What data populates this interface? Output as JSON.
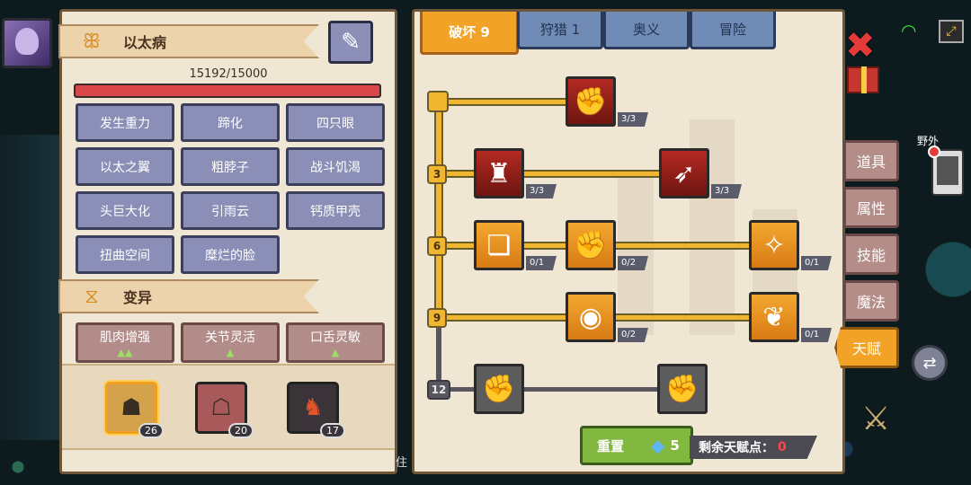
{
  "left_panel": {
    "disease": {
      "name": "以太病",
      "hp_text": "15192/15000",
      "hp_fraction": 1.0
    },
    "traits": [
      "发生重力",
      "蹄化",
      "四只眼",
      "以太之翼",
      "粗脖子",
      "战斗饥渴",
      "头巨大化",
      "引雨云",
      "钙质甲壳",
      "扭曲空间",
      "糜烂的脸"
    ],
    "mutation": {
      "title": "变异",
      "items": [
        {
          "label": "肌肉增强",
          "arrows": "▲▲"
        },
        {
          "label": "关节灵活",
          "arrows": "▲"
        },
        {
          "label": "口舌灵敏",
          "arrows": "▲"
        }
      ]
    },
    "pets": [
      {
        "level": "26",
        "selected": true,
        "icon": "golem-icon"
      },
      {
        "level": "20",
        "selected": false,
        "icon": "robot-icon"
      },
      {
        "level": "17",
        "selected": false,
        "icon": "dragon-icon"
      }
    ]
  },
  "tabs": [
    {
      "label": "破坏 9",
      "active": true
    },
    {
      "label": "狩猎 1",
      "active": false
    },
    {
      "label": "奥义",
      "active": false
    },
    {
      "label": "冒险",
      "active": false
    }
  ],
  "talent_tree": {
    "tiers": [
      "3",
      "6",
      "9",
      "12"
    ],
    "nodes": [
      {
        "id": "arm-wrestle",
        "icon": "arm-wrestle-icon",
        "count": "3/3",
        "style": "red"
      },
      {
        "id": "muscle-body",
        "icon": "muscle-body-icon",
        "count": "3/3",
        "style": "red"
      },
      {
        "id": "arrow-hit",
        "icon": "arrow-hit-icon",
        "count": "3/3",
        "style": "red"
      },
      {
        "id": "card-slash",
        "icon": "card-slash-icon",
        "count": "0/1",
        "style": "orange"
      },
      {
        "id": "fist-punch",
        "icon": "fist-punch-icon",
        "count": "0/2",
        "style": "orange"
      },
      {
        "id": "splash-blade",
        "icon": "splash-blade-icon",
        "count": "0/1",
        "style": "orange"
      },
      {
        "id": "ring-pulse",
        "icon": "ring-pulse-icon",
        "count": "0/2",
        "style": "orange"
      },
      {
        "id": "bat-wings",
        "icon": "bat-wings-icon",
        "count": "0/1",
        "style": "orange"
      },
      {
        "id": "locked-fist-a",
        "icon": "fist-icon",
        "count": "",
        "style": "gray"
      },
      {
        "id": "locked-fist-b",
        "icon": "fist-icon",
        "count": "",
        "style": "gray"
      }
    ]
  },
  "reset": {
    "label": "重置",
    "cost": "5"
  },
  "remaining": {
    "label": "剩余天赋点：",
    "value": "0"
  },
  "side_tabs": [
    {
      "label": "道具",
      "active": false
    },
    {
      "label": "属性",
      "active": false
    },
    {
      "label": "技能",
      "active": false
    },
    {
      "label": "魔法",
      "active": false
    },
    {
      "label": "天赋",
      "active": true
    }
  ],
  "hud": {
    "area_label": "野外",
    "partial_text": "住"
  },
  "colors": {
    "accent": "#f2a226",
    "hp": "#d9474a",
    "trait": "#8b8eb6",
    "mutation": "#b28c89",
    "reset": "#82b840"
  }
}
